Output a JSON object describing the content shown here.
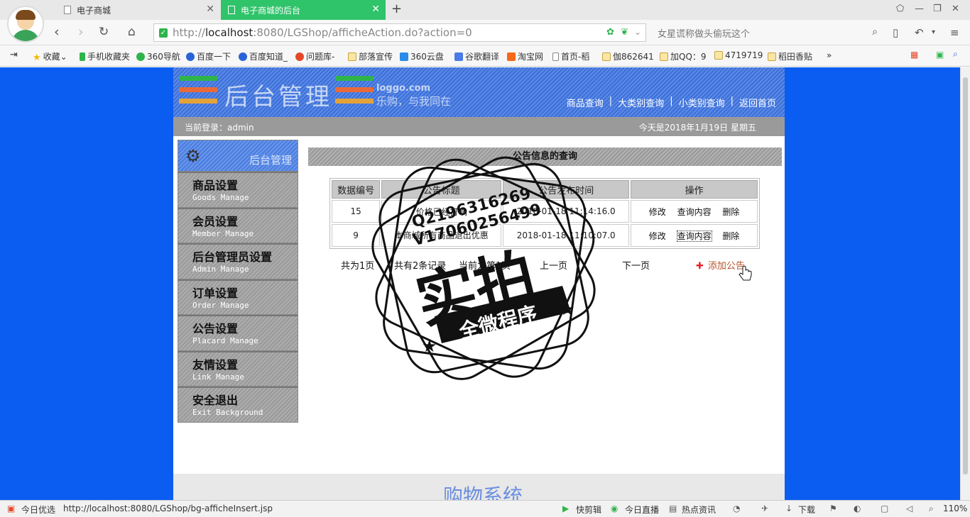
{
  "browser": {
    "tabs": [
      {
        "title": "电子商城"
      },
      {
        "title": "电子商城的后台"
      }
    ],
    "url_prefix": "http://",
    "url_host": "localhost",
    "url_rest": ":8080/LGShop/afficheAction.do?action=0",
    "search_placeholder": "女星谎称做头偷玩这个",
    "bookmarks": [
      "收藏",
      "手机收藏夹",
      "360导航",
      "百度一下",
      "百度知道_",
      "问题库-",
      "部落宣传",
      "360云盘",
      "谷歌翻译",
      "淘宝网",
      "首页-稻",
      "伽862641",
      "加QQ：9",
      "4719719",
      "稻田香贴"
    ],
    "bookmark_more": "»"
  },
  "site": {
    "header_title": "后台管理",
    "logo_text": "loggo.com",
    "slogan": "乐购，与我同在",
    "topnav": [
      "商品查询",
      "大类别查询",
      "小类别查询",
      "返回首页"
    ],
    "topnav_sep": "|",
    "login_label": "当前登录：admin",
    "date_text": "今天是2018年1月19日  星期五"
  },
  "sidebar": {
    "header": "后台管理",
    "items": [
      {
        "cn": "商品设置",
        "en": "Goods Manage"
      },
      {
        "cn": "会员设置",
        "en": "Member Manage"
      },
      {
        "cn": "后台管理员设置",
        "en": "Admin Manage"
      },
      {
        "cn": "订单设置",
        "en": "Order Manage"
      },
      {
        "cn": "公告设置",
        "en": "Placard Manage"
      },
      {
        "cn": "友情设置",
        "en": "Link Manage"
      },
      {
        "cn": "安全退出",
        "en": "Exit Background"
      }
    ]
  },
  "content": {
    "title": "公告信息的查询",
    "columns": [
      "数据编号",
      "公告标题",
      "公告发布时间",
      "操作"
    ],
    "rows": [
      {
        "id": "15",
        "title": "价格已经打响",
        "time": "2018-01-18 11:14:16.0"
      },
      {
        "id": "9",
        "title": "本商城所有商品退出优惠",
        "time": "2018-01-18 11:10:07.0"
      }
    ],
    "actions": [
      "修改",
      "查询内容",
      "删除"
    ],
    "pager": {
      "total_pages": "共为1页",
      "total_records": "共有2条记录",
      "current": "当前为第1页",
      "prev": "上一页",
      "next": "下一页"
    },
    "add_link": "添加公告",
    "footer_text": "购物系统"
  },
  "watermark": {
    "qq1": "Q2196316269",
    "qq2": "V17060256499",
    "big": "实拍",
    "ribbon": "全微程序"
  },
  "statusbar": {
    "left_label": "今日优选",
    "url": "http://localhost:8080/LGShop/bg-afficheInsert.jsp",
    "items": [
      "快剪辑",
      "今日直播",
      "热点资讯",
      "下载"
    ],
    "zoom": "110%"
  }
}
